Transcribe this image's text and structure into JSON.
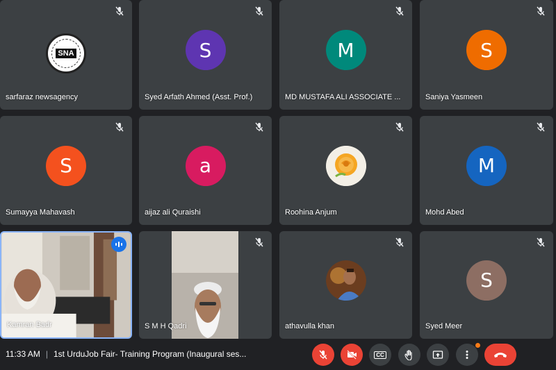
{
  "participants": [
    {
      "name": "sarfaraz newsagency",
      "type": "logo",
      "logo_text": "SNA"
    },
    {
      "name": "Syed Arfath Ahmed (Asst. Prof.)",
      "type": "letter",
      "initial": "S",
      "color": "#5e35b1"
    },
    {
      "name": "MD MUSTAFA ALI ASSOCIATE ...",
      "type": "letter",
      "initial": "M",
      "color": "#00897b"
    },
    {
      "name": "Saniya Yasmeen",
      "type": "letter",
      "initial": "S",
      "color": "#ef6c00"
    },
    {
      "name": "Sumayya Mahavash",
      "type": "letter",
      "initial": "S",
      "color": "#f4511e"
    },
    {
      "name": "aijaz ali Quraishi",
      "type": "letter",
      "initial": "a",
      "color": "#d81b60"
    },
    {
      "name": "Roohina Anjum",
      "type": "photo",
      "photo": "rose"
    },
    {
      "name": "Mohd Abed",
      "type": "letter",
      "initial": "M",
      "color": "#1565c0"
    },
    {
      "name": "Kamran Badr",
      "type": "video",
      "speaking": true
    },
    {
      "name": "S M H Qadri",
      "type": "video"
    },
    {
      "name": "athavulla khan",
      "type": "photo",
      "photo": "man"
    },
    {
      "name": "Syed Meer",
      "type": "letter",
      "initial": "S",
      "color": "#8d6e63"
    }
  ],
  "bottom_bar": {
    "time": "11:33 AM",
    "separator": "|",
    "meeting_title": "1st UrduJob Fair- Training Program (Inaugural ses...",
    "controls": [
      "mic-off-icon",
      "camera-off-icon",
      "captions-icon",
      "raise-hand-icon",
      "present-icon",
      "more-options-icon",
      "end-call-icon"
    ],
    "captions_label": "CC"
  },
  "colors": {
    "tile_bg": "#3c4043",
    "page_bg": "#202124",
    "danger": "#ea4335",
    "accent": "#1a73e8"
  }
}
